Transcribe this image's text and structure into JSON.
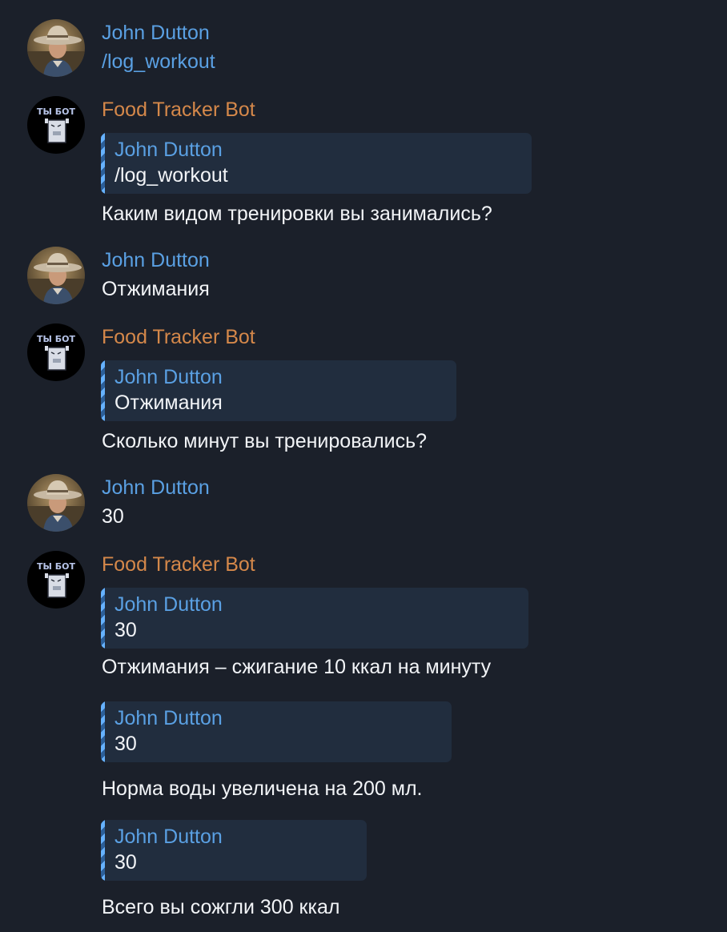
{
  "app": {
    "accent_user": "#5aa0e3",
    "accent_bot": "#d5884a",
    "background": "#1b202a"
  },
  "avatars": {
    "user_icon": "cowboy-photo-avatar",
    "bot_icon": "robot-avatar",
    "bot_badge": "ТЫ БОТ"
  },
  "messages": [
    {
      "sender": "John Dutton",
      "text": "/log_workout"
    },
    {
      "sender": "Food Tracker Bot",
      "quote_name": "John Dutton",
      "quote_text": "/log_workout",
      "text": "Каким видом тренировки вы занимались?"
    },
    {
      "sender": "John Dutton",
      "text": "Отжимания"
    },
    {
      "sender": "Food Tracker Bot",
      "quote_name": "John Dutton",
      "quote_text": "Отжимания",
      "text": "Сколько минут вы тренировались?"
    },
    {
      "sender": "John Dutton",
      "text": "30"
    },
    {
      "sender": "Food Tracker Bot",
      "quote_name": "John Dutton",
      "quote_text": "30",
      "text": "Отжимания – сжигание 10 ккал на минуту"
    },
    {
      "quote_name": "John Dutton",
      "quote_text": "30",
      "text": "Норма воды увеличена на 200 мл."
    },
    {
      "quote_name": "John Dutton",
      "quote_text": "30",
      "text": "Всего вы сожгли 300 ккал"
    }
  ]
}
